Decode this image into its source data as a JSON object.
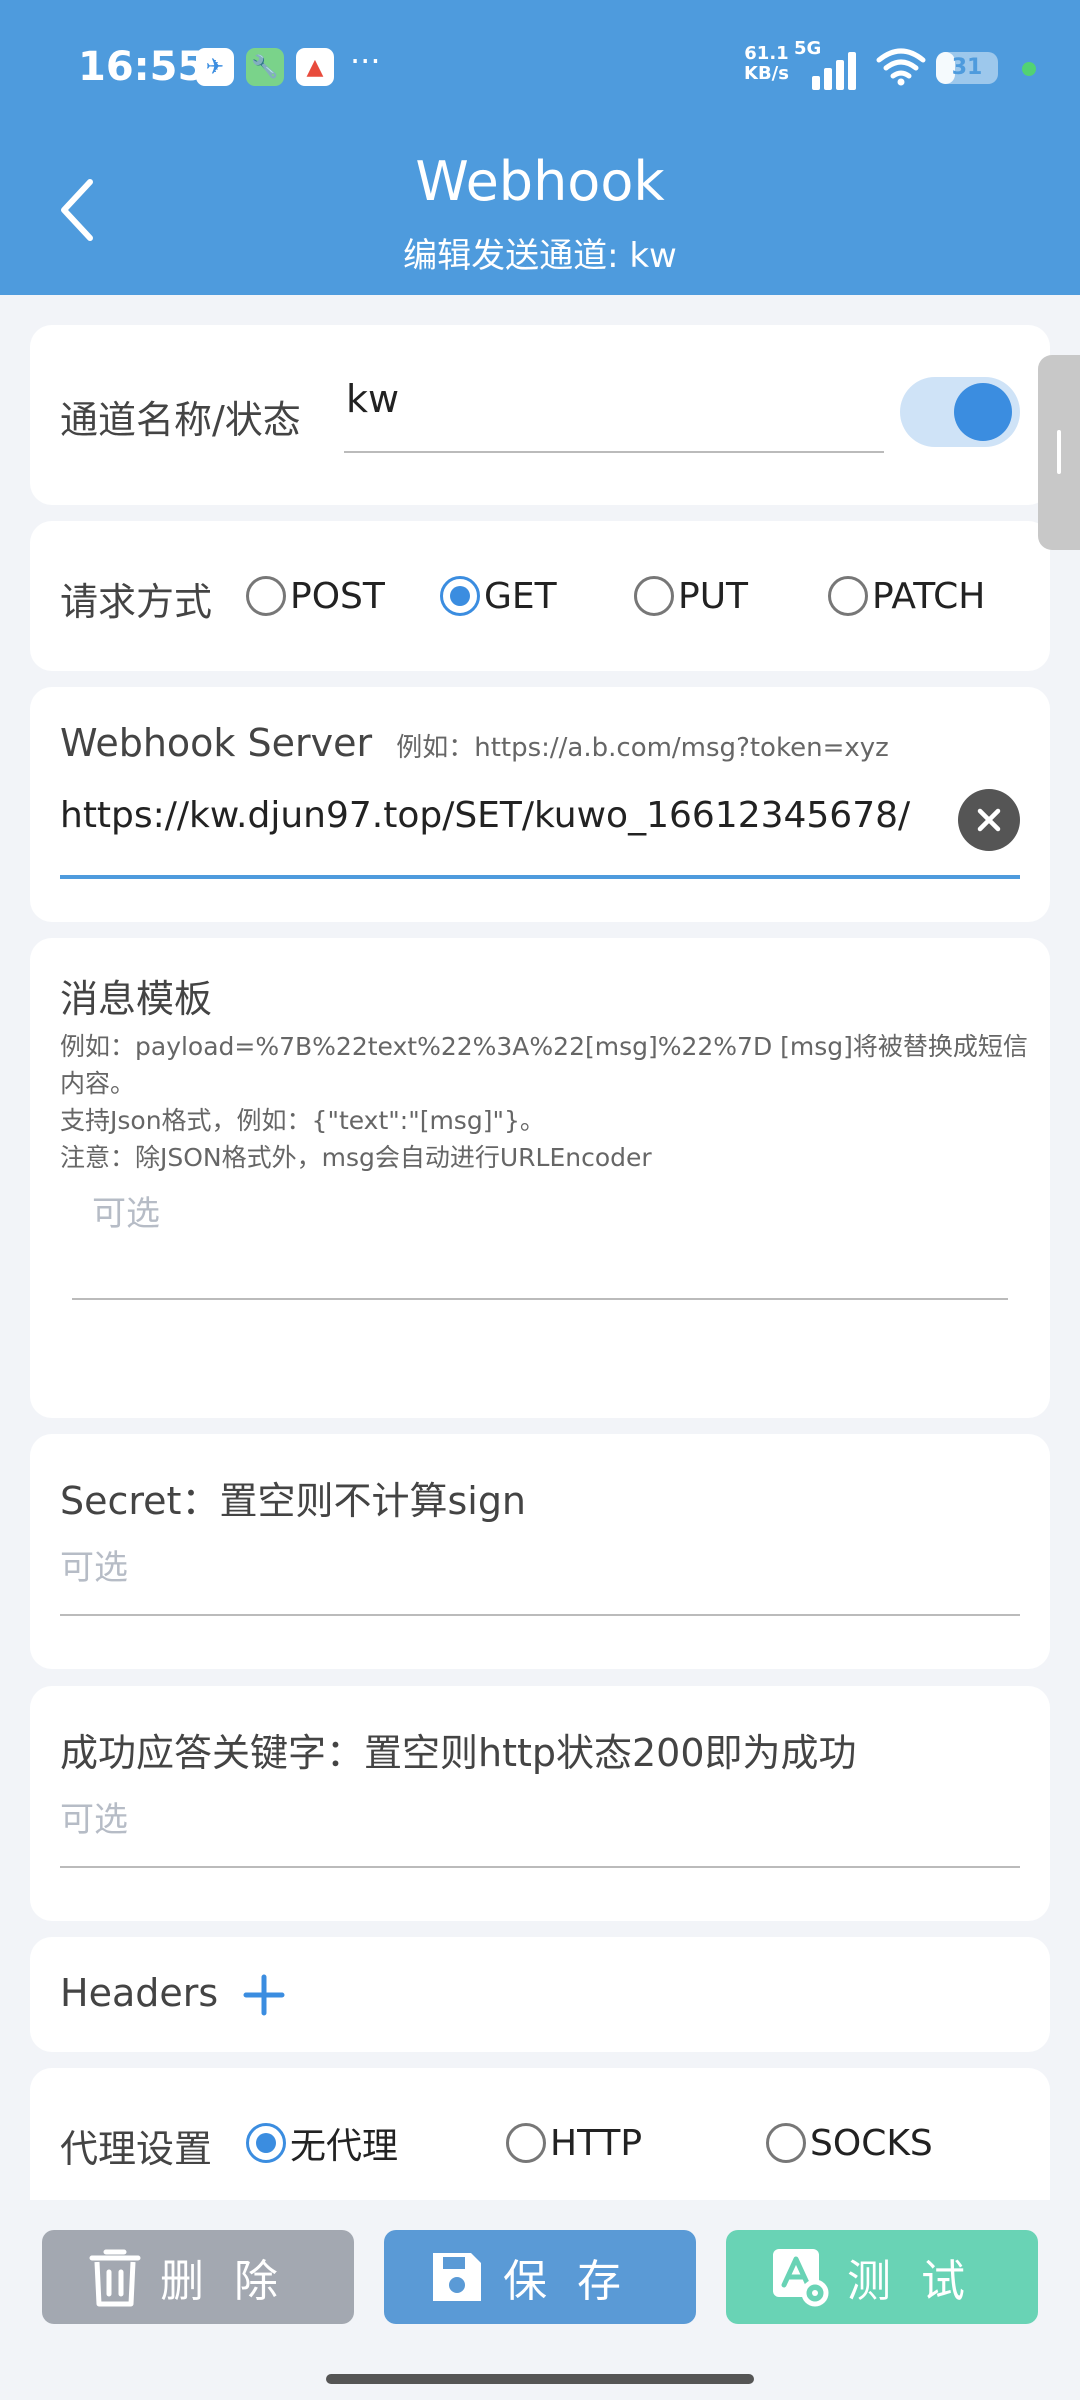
{
  "status_bar": {
    "time": "16:55",
    "more": "···",
    "net_speed_value": "61.1",
    "net_speed_unit": "KB/s",
    "network": "5G",
    "battery": "31",
    "battery_level": 0.31,
    "app_icons": [
      "paper-plane-app-icon",
      "wrench-app-icon",
      "colorful-app-icon"
    ]
  },
  "header": {
    "title": "Webhook",
    "subtitle": "编辑发送通道: kw"
  },
  "channel": {
    "label": "通道名称/状态",
    "name_value": "kw",
    "enabled": true
  },
  "method": {
    "label": "请求方式",
    "options": [
      "POST",
      "GET",
      "PUT",
      "PATCH"
    ],
    "selected": "GET"
  },
  "server": {
    "label": "Webhook Server",
    "hint": "例如：https://a.b.com/msg?token=xyz",
    "value": "https://kw.djun97.top/SET/kuwo_16612345678/"
  },
  "template": {
    "label": "消息模板",
    "hint_line1": "例如：payload=%7B%22text%22%3A%22[msg]%22%7D [msg]将被替换成短信",
    "hint_line2": "内容。",
    "hint_line3": "支持Json格式，例如：{\"text\":\"[msg]\"}。",
    "hint_line4": "注意：除JSON格式外，msg会自动进行URLEncoder",
    "placeholder": "可选"
  },
  "secret": {
    "label": "Secret：置空则不计算sign",
    "placeholder": "可选"
  },
  "keyword": {
    "label": "成功应答关键字：置空则http状态200即为成功",
    "placeholder": "可选"
  },
  "headers": {
    "label": "Headers"
  },
  "proxy": {
    "label": "代理设置",
    "options": [
      "无代理",
      "HTTP",
      "SOCKS"
    ],
    "selected": "无代理"
  },
  "actions": {
    "delete_label": "删除",
    "save_label": "保存",
    "test_label": "测试",
    "delete_color": "#a3a8b1",
    "save_color": "#5a9ad6",
    "test_color": "#69d3b5"
  },
  "colors": {
    "header": "#4e9bdd",
    "accent": "#3b8de0",
    "background": "#f2f4f8"
  }
}
